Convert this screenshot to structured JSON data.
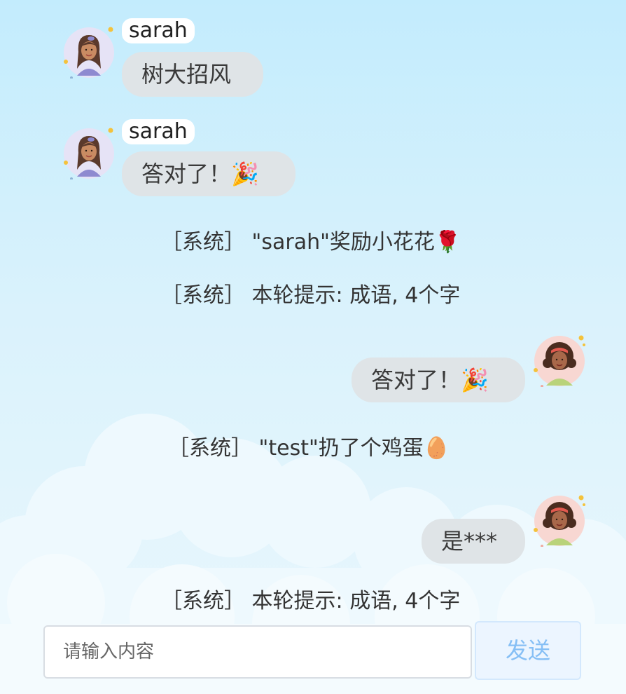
{
  "messages": [
    {
      "user": "sarah",
      "text": "树大招风"
    },
    {
      "user": "sarah",
      "text": "答对了！🎉"
    }
  ],
  "system_messages": [
    {
      "tag": "［系统］",
      "text": "\"sarah\"奖励小花花🌹"
    },
    {
      "tag": "［系统］",
      "text": "本轮提示: 成语, 4个字"
    },
    {
      "tag": "［系统］",
      "text": "\"test\"扔了个鸡蛋🥚"
    },
    {
      "tag": "［系统］",
      "text": "本轮提示: 成语, 4个字"
    }
  ],
  "my_messages": [
    {
      "text": "答对了！🎉"
    },
    {
      "text": "是***"
    }
  ],
  "input": {
    "placeholder": "请输入内容",
    "value": ""
  },
  "send_button": {
    "label": "发送"
  },
  "colors": {
    "bubble": "#dfe4e7",
    "send_text": "#86bff5",
    "send_bg": "#ecf5ff"
  }
}
